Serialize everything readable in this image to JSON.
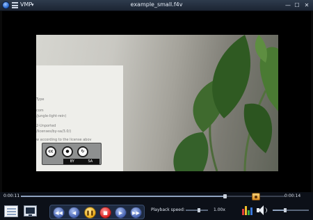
{
  "window": {
    "app_name": "VMP",
    "title": "example_small.f4v",
    "minimize": "—",
    "maximize": "☐",
    "close": "✕"
  },
  "video": {
    "paper_lines": [
      "Type",
      "com",
      "/jungle-light-rein)",
      "2-Unported",
      "/licenses/by-sa/3.0/)",
      "w according to the license abov"
    ],
    "cc_badge": {
      "cc": "cc",
      "by": "BY",
      "sa": "SA"
    }
  },
  "playback": {
    "current_time": "0:00:11",
    "total_time": "0:00:14",
    "progress_fraction": 0.77,
    "transport": {
      "prev": "◀◀",
      "rewind": "◀",
      "play_pause": "❚❚",
      "stop": "■",
      "forward": "▶",
      "next": "▶▶"
    },
    "speed_label": "Playback speed:",
    "speed_value": "1.00x",
    "volume_fraction": 0.35
  },
  "colors": {
    "accent_blue": "#4a66b3",
    "pause_yellow": "#f0b21d",
    "stop_red": "#e02626"
  },
  "icons": [
    "app-logo-icon",
    "menu-icon",
    "playlist-icon",
    "screen-icon",
    "snapshot-icon",
    "equalizer-icon",
    "volume-icon"
  ]
}
